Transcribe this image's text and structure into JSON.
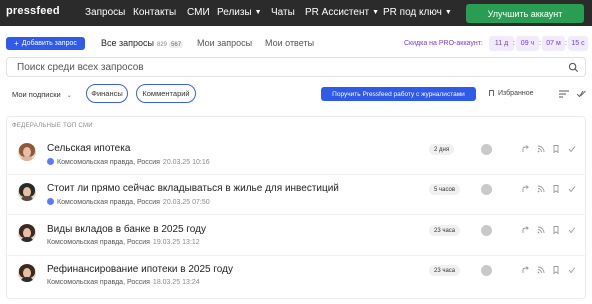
{
  "header": {
    "logo": "pressfeed",
    "nav": [
      {
        "label": "Запросы",
        "chevron": false
      },
      {
        "label": "Контакты",
        "chevron": false
      },
      {
        "label": "СМИ",
        "chevron": false
      },
      {
        "label": "Релизы",
        "chevron": true
      },
      {
        "label": "Чаты",
        "chevron": false
      },
      {
        "label": "PR Ассистент",
        "chevron": true
      },
      {
        "label": "PR под ключ",
        "chevron": true
      }
    ],
    "upgrade_label": "Улучшить аккаунт"
  },
  "toolbar": {
    "add_label": "Добавить запрос",
    "tabs": [
      {
        "label": "Все запросы",
        "count": "829",
        "badge": "567"
      },
      {
        "label": "Мои запросы"
      },
      {
        "label": "Мои ответы"
      }
    ],
    "discount_label": "Скидка на PRO-аккаунт:",
    "timer": {
      "days": "11",
      "days_unit": "д",
      "hours": "09",
      "hours_unit": "ч",
      "minutes": "07",
      "minutes_unit": "м",
      "seconds": "15",
      "seconds_unit": "с",
      "sep": ":"
    }
  },
  "search": {
    "placeholder": "Поиск среди всех запросов"
  },
  "filters": {
    "subscriptions_label": "Мои подписки",
    "chips": [
      "Финансы",
      "Комментарий"
    ],
    "pressfeed_button": "Поручить Pressfeed работу с журналистами",
    "favorites_label": "Избранное"
  },
  "list": {
    "section_title": "ФЕДЕРАЛЬНЫЕ ТОП СМИ",
    "items": [
      {
        "title": "Сельская ипотека",
        "source": "Комсомольская правда, Россия",
        "date": "20.03.25 10:16",
        "verified": true,
        "time_badge": "2 дня"
      },
      {
        "title": "Стоит ли прямо сейчас вкладываться в жилье для инвестиций",
        "source": "Комсомольская правда, Россия",
        "date": "20.03.25 07:50",
        "verified": true,
        "time_badge": "5 часов"
      },
      {
        "title": "Виды вкладов в банке в 2025 году",
        "source": "Комсомольская правда, Россия",
        "date": "19.03.25 13:12",
        "verified": false,
        "time_badge": "23 часа"
      },
      {
        "title": "Рефинансирование ипотеки в 2025 году",
        "source": "Комсомольская правда, Россия",
        "date": "18.03.25 13:24",
        "verified": false,
        "time_badge": "23 часа"
      }
    ]
  },
  "colors": {
    "nav_bg": "#2b2b2b",
    "accent_blue": "#2f5be8",
    "upgrade_green": "#2a9d54",
    "promo_purple": "#7a3fd0"
  }
}
